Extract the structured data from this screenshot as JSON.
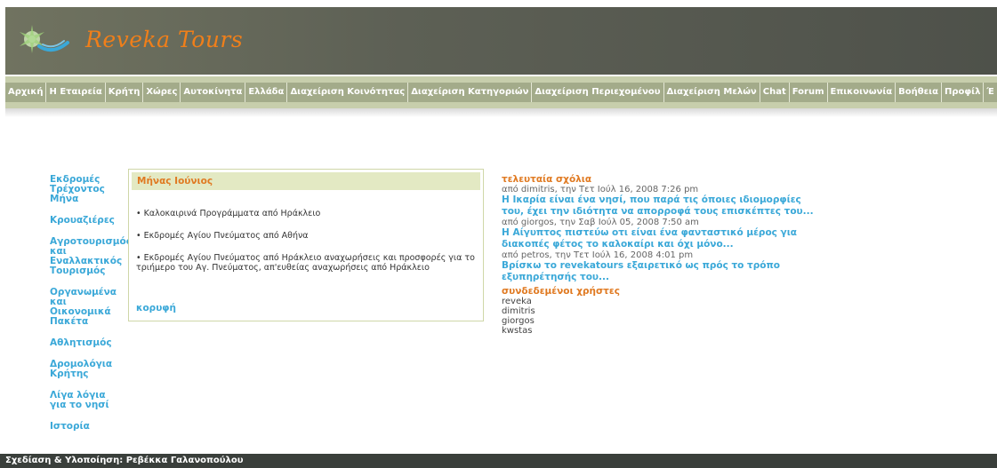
{
  "header": {
    "site_title": "Reveka Tours",
    "logo_icon": "flower-logo-icon",
    "colors": {
      "header": "#5d6055",
      "title": "#f07f1a",
      "nav": "#a3ab8a"
    }
  },
  "nav": {
    "items": [
      "Αρχική",
      "Η Εταιρεία",
      "Κρήτη",
      "Χώρες",
      "Αυτοκίνητα",
      "Ελλάδα",
      "Διαχείριση Κοινότητας",
      "Διαχείριση Κατηγοριών",
      "Διαχείριση Περιεχομένου",
      "Διαχείριση Μελών",
      "Chat",
      "Forum",
      "Επικοινωνία",
      "Βοήθεια",
      "Προφίλ",
      "Έ"
    ]
  },
  "sidebar": {
    "items": [
      "Εκδρομές Τρέχοντος Μήνα",
      "Κρουαζιέρες",
      "Αγροτουρισμός και Εναλλακτικός Τουρισμός",
      "Οργανωμένα και Οικονομικά Πακέτα",
      "Αθλητισμός",
      "Δρομολόγια Κρήτης",
      "Λίγα λόγια για το νησί",
      "Ιστορία"
    ]
  },
  "panel": {
    "title": "Μήνας Ιούνιος",
    "items": [
      "• Καλοκαιρινά Προγράμματα από Ηράκλειο",
      "• Εκδρομές Αγίου Πνεύματος από Αθήνα",
      "• Εκδρομές Αγίου Πνεύματος από Ηράκλειο αναχωρήσεις και προσφορές για το τριήμερο του Αγ. Πνεύματος, απ'ευθείας αναχωρήσεις από Ηράκλειο"
    ],
    "top_link": "κορυφή"
  },
  "latest": {
    "title": "τελευταία σχόλια",
    "comments": [
      {
        "meta": "από dimitris, την Τετ Ιούλ 16, 2008 7:26 pm",
        "text": "Η Ικαρία είναι ένα νησί, που παρά τις όποιες ιδιομορφίες του, έχει την ιδιότητα να απορροφά τους επισκέπτες του..."
      },
      {
        "meta": "από giorgos, την Σαβ Ιούλ 05, 2008 7:50 am",
        "text": "Η Αίγυπτος πιστεύω οτι είναι ένα φανταστικό μέρος για διακοπές φέτος το καλοκαίρι και όχι μόνο..."
      },
      {
        "meta": "από petros, την Τετ Ιούλ 16, 2008 4:01 pm",
        "text": "Βρίσκω το revekatours εξαιρετικό ως πρός το τρόπο εξυπηρέτησής του..."
      }
    ]
  },
  "users": {
    "title": "συνδεδεμένοι χρήστες",
    "list": [
      "reveka",
      "dimitris",
      "giorgos",
      "kwstas"
    ]
  },
  "footer": {
    "text": "Σχεδίαση & Υλοποίηση: Ρεβέκκα Γαλανοπούλου"
  }
}
